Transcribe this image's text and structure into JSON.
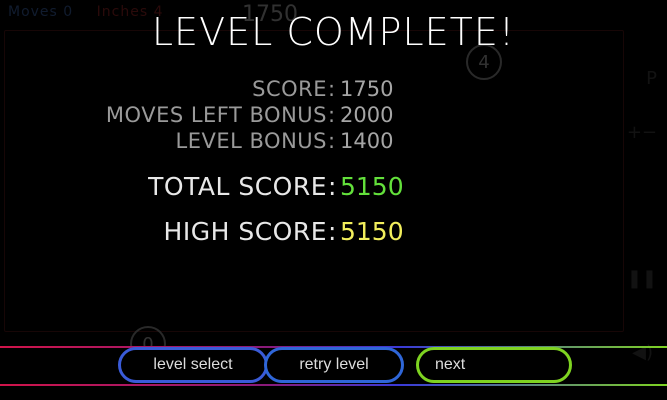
{
  "hud": {
    "top_left_a": "Moves 0",
    "top_left_b": "Inches 4",
    "score": "1750",
    "circle_top": "4",
    "circle_bottom": "0"
  },
  "dialog": {
    "title": "LEVEL COMPLETE!",
    "rows": [
      {
        "label": "SCORE",
        "value": "1750"
      },
      {
        "label": "MOVES LEFT BONUS",
        "value": "2000"
      },
      {
        "label": "LEVEL BONUS",
        "value": "1400"
      }
    ],
    "total_label": "TOTAL SCORE",
    "total_value": "5150",
    "high_label": "HIGH SCORE",
    "high_value": "5150",
    "colon": ":"
  },
  "buttons": {
    "level_select": "level select",
    "retry_level": "retry level",
    "next": "next"
  },
  "colors": {
    "total": "#63e03b",
    "high": "#f2ee5c",
    "level_select_border": "#3a5bd8",
    "retry_border": "#2f66d8",
    "next_border": "#7ed321"
  },
  "icons": [
    "pause-icon",
    "sound-icon",
    "zoom-icon"
  ]
}
